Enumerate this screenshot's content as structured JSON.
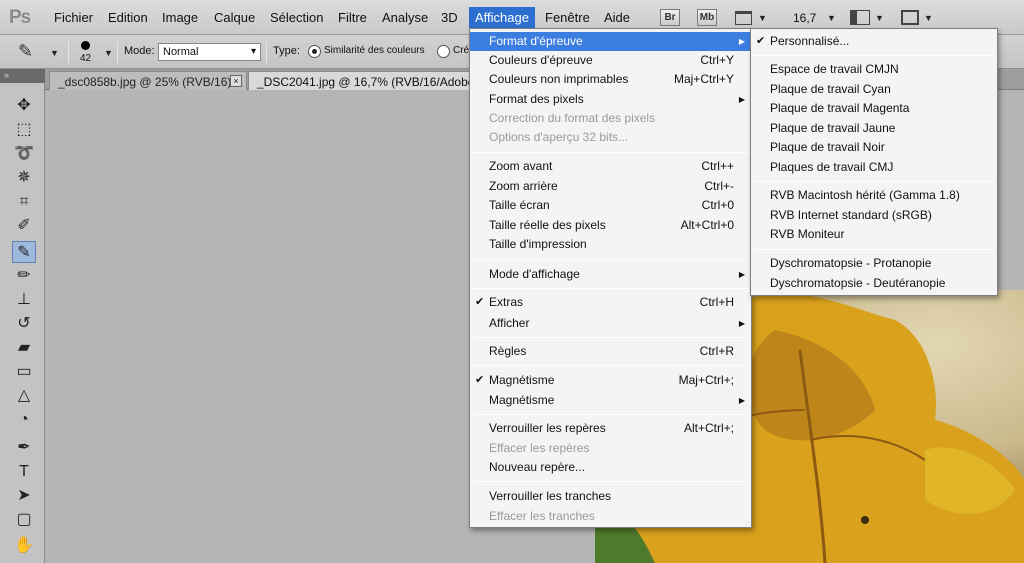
{
  "menubar": {
    "logo": "Ps",
    "items": [
      "Fichier",
      "Edition",
      "Image",
      "Calque",
      "Sélection",
      "Filtre",
      "Analyse",
      "3D",
      "Affichage",
      "Fenêtre",
      "Aide"
    ],
    "badges": [
      "Br",
      "Mb"
    ],
    "zoom": "16,7"
  },
  "options": {
    "brush_size": "42",
    "mode_label": "Mode:",
    "mode_value": "Normal",
    "type_label": "Type:",
    "type_option_1": "Similarité des couleurs",
    "type_option_2": "Cré"
  },
  "tabs": [
    {
      "label": "_dsc0858b.jpg @ 25% (RVB/16)",
      "close": "×"
    },
    {
      "label": "_DSC2041.jpg @ 16,7% (RVB/16/Adobe R"
    }
  ],
  "affichage_menu": {
    "items": [
      {
        "label": "Format d'épreuve",
        "arrow": "▶"
      },
      {
        "label": "Couleurs d'épreuve",
        "shortcut": "Ctrl+Y"
      },
      {
        "label": "Couleurs non imprimables",
        "shortcut": "Maj+Ctrl+Y"
      },
      {
        "label": "Format des pixels",
        "arrow": "▶"
      },
      {
        "label": "Correction du format des pixels"
      },
      {
        "label": "Options d'aperçu 32 bits..."
      },
      {
        "label": "Zoom avant",
        "shortcut": "Ctrl++"
      },
      {
        "label": "Zoom arrière",
        "shortcut": "Ctrl+-"
      },
      {
        "label": "Taille écran",
        "shortcut": "Ctrl+0"
      },
      {
        "label": "Taille réelle des pixels",
        "shortcut": "Alt+Ctrl+0"
      },
      {
        "label": "Taille d'impression"
      },
      {
        "label": "Mode d'affichage",
        "arrow": "▶"
      },
      {
        "label": "Extras",
        "shortcut": "Ctrl+H",
        "check": "✔"
      },
      {
        "label": "Afficher",
        "arrow": "▶"
      },
      {
        "label": "Règles",
        "shortcut": "Ctrl+R"
      },
      {
        "label": "Magnétisme",
        "shortcut": "Maj+Ctrl+;",
        "check": "✔"
      },
      {
        "label": "Magnétisme",
        "arrow": "▶"
      },
      {
        "label": "Verrouiller les repères",
        "shortcut": "Alt+Ctrl+;"
      },
      {
        "label": "Effacer les repères"
      },
      {
        "label": "Nouveau repère..."
      },
      {
        "label": "Verrouiller les tranches"
      },
      {
        "label": "Effacer les tranches"
      }
    ]
  },
  "format_submenu": {
    "items": [
      {
        "label": "Personnalisé...",
        "check": "✔"
      },
      {
        "label": "Espace de travail CMJN"
      },
      {
        "label": "Plaque de travail Cyan"
      },
      {
        "label": "Plaque de travail Magenta"
      },
      {
        "label": "Plaque de travail Jaune"
      },
      {
        "label": "Plaque de travail Noir"
      },
      {
        "label": "Plaques de travail CMJ"
      },
      {
        "label": "RVB Macintosh hérité (Gamma 1.8)"
      },
      {
        "label": "RVB Internet standard (sRGB)"
      },
      {
        "label": "RVB Moniteur"
      },
      {
        "label": "Dyschromatopsie - Protanopie"
      },
      {
        "label": "Dyschromatopsie - Deutéranopie"
      }
    ]
  }
}
